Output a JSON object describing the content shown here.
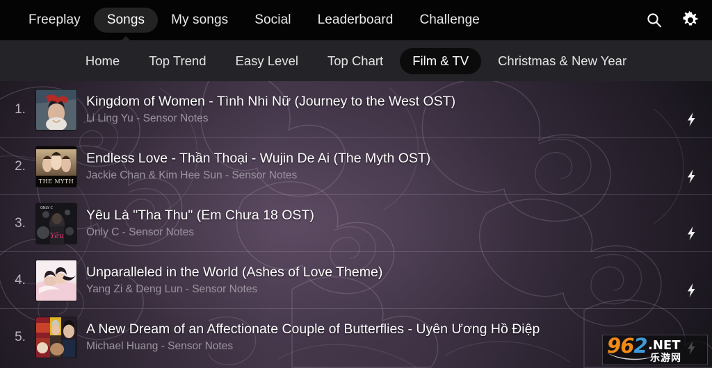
{
  "app": {
    "accent_active_pill": "#232323",
    "subnav_bar_color": "#242428",
    "title_color": "#ffffff",
    "artist_color": "#9b949f"
  },
  "topnav": {
    "items": [
      {
        "label": "Freeplay",
        "active": false
      },
      {
        "label": "Songs",
        "active": true
      },
      {
        "label": "My songs",
        "active": false
      },
      {
        "label": "Social",
        "active": false
      },
      {
        "label": "Leaderboard",
        "active": false
      },
      {
        "label": "Challenge",
        "active": false
      }
    ],
    "actions": [
      {
        "name": "search-icon",
        "label": "Search"
      },
      {
        "name": "gear-icon",
        "label": "Settings"
      }
    ]
  },
  "subnav": {
    "items": [
      {
        "label": "Home",
        "active": false
      },
      {
        "label": "Top Trend",
        "active": false
      },
      {
        "label": "Easy Level",
        "active": false
      },
      {
        "label": "Top Chart",
        "active": false
      },
      {
        "label": "Film & TV",
        "active": true
      },
      {
        "label": "Christmas & New Year",
        "active": false
      }
    ]
  },
  "songs": [
    {
      "rank": "1.",
      "title": "Kingdom of Women - Tình Nhi Nữ (Journey to the West OST)",
      "artist": "Li Ling Yu - Sensor Notes",
      "action_icon": "lightning-bolt-icon"
    },
    {
      "rank": "2.",
      "title": "Endless Love - Thần Thoại - Wujin De Ai (The Myth OST)",
      "artist": "Jackie Chan & Kim Hee Sun - Sensor Notes",
      "action_icon": "lightning-bolt-icon"
    },
    {
      "rank": "3.",
      "title": "Yêu Là \"Tha Thu\" (Em Chưa 18 OST)",
      "artist": "Only C - Sensor Notes",
      "action_icon": "lightning-bolt-icon"
    },
    {
      "rank": "4.",
      "title": "Unparalleled in the World (Ashes of Love Theme)",
      "artist": "Yang Zi & Deng Lun - Sensor Notes",
      "action_icon": "lightning-bolt-icon"
    },
    {
      "rank": "5.",
      "title": "A New Dream of an Affectionate Couple of Butterflies - Uyên Ương Hồ Điệp",
      "artist": "Michael Huang - Sensor Notes",
      "action_icon": "lightning-bolt-icon"
    }
  ],
  "album_art_labels": {
    "row2_caption": "THE MYTH",
    "row3_caption": "ONLY C"
  },
  "watermark": {
    "digit9": "9",
    "digit6": "6",
    "digit2": "2",
    "net": ".NET",
    "chinese": "乐游网"
  }
}
